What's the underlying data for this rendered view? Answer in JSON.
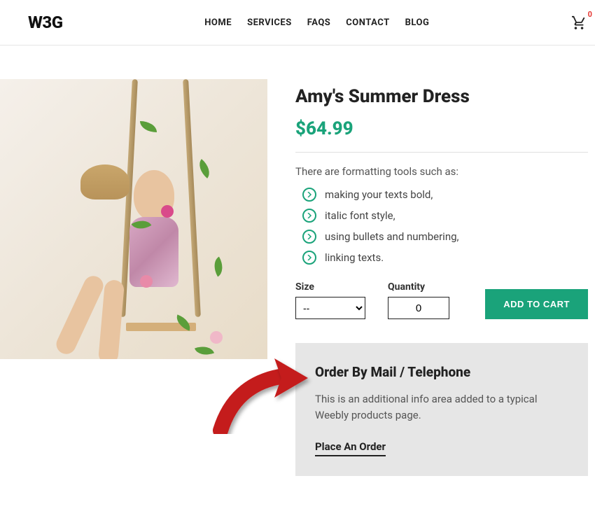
{
  "header": {
    "logo": "W3G",
    "nav": [
      "HOME",
      "SERVICES",
      "FAQS",
      "CONTACT",
      "BLOG"
    ],
    "cart_count": "0"
  },
  "product": {
    "title": "Amy's Summer Dress",
    "price": "$64.99",
    "intro": "There are formatting tools such as:",
    "features": [
      "making your texts bold,",
      "italic font style,",
      "using bullets and numbering,",
      "linking texts."
    ],
    "size_label": "Size",
    "size_selected": "--",
    "quantity_label": "Quantity",
    "quantity_value": "0",
    "add_to_cart": "ADD TO CART"
  },
  "info_box": {
    "title": "Order By Mail / Telephone",
    "description": "This is an additional info area added to a typical Weebly products page.",
    "cta": "Place An Order"
  },
  "colors": {
    "accent": "#1aa37a",
    "badge": "#e53935"
  }
}
